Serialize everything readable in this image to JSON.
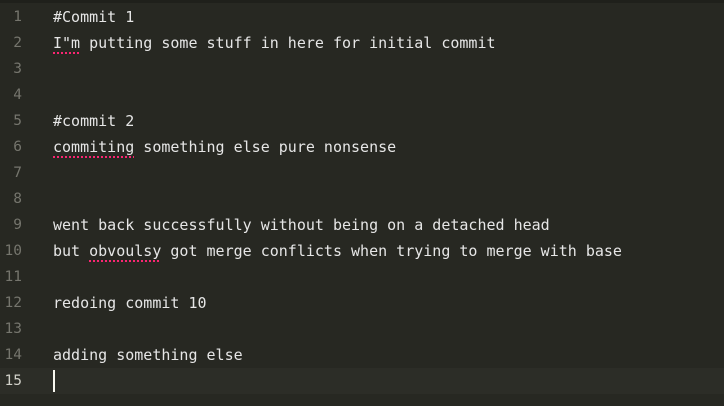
{
  "editor": {
    "lines": [
      {
        "num": "1",
        "pre": "#Commit 1",
        "err": "",
        "post": ""
      },
      {
        "num": "2",
        "pre": "",
        "err": "I\"m",
        "post": " putting some stuff in here for initial commit"
      },
      {
        "num": "3",
        "pre": "",
        "err": "",
        "post": ""
      },
      {
        "num": "4",
        "pre": "",
        "err": "",
        "post": ""
      },
      {
        "num": "5",
        "pre": "#commit 2",
        "err": "",
        "post": ""
      },
      {
        "num": "6",
        "pre": "",
        "err": "commiting",
        "post": " something else pure nonsense"
      },
      {
        "num": "7",
        "pre": "",
        "err": "",
        "post": ""
      },
      {
        "num": "8",
        "pre": "",
        "err": "",
        "post": ""
      },
      {
        "num": "9",
        "pre": "went back successfully without being on a detached head",
        "err": "",
        "post": ""
      },
      {
        "num": "10",
        "pre": "but ",
        "err": "obvoulsy",
        "post": " got merge conflicts when trying to merge with base"
      },
      {
        "num": "11",
        "pre": "",
        "err": "",
        "post": ""
      },
      {
        "num": "12",
        "pre": "redoing commit 10",
        "err": "",
        "post": ""
      },
      {
        "num": "13",
        "pre": "",
        "err": "",
        "post": ""
      },
      {
        "num": "14",
        "pre": "adding something else",
        "err": "",
        "post": ""
      },
      {
        "num": "15",
        "pre": "",
        "err": "",
        "post": ""
      }
    ]
  }
}
